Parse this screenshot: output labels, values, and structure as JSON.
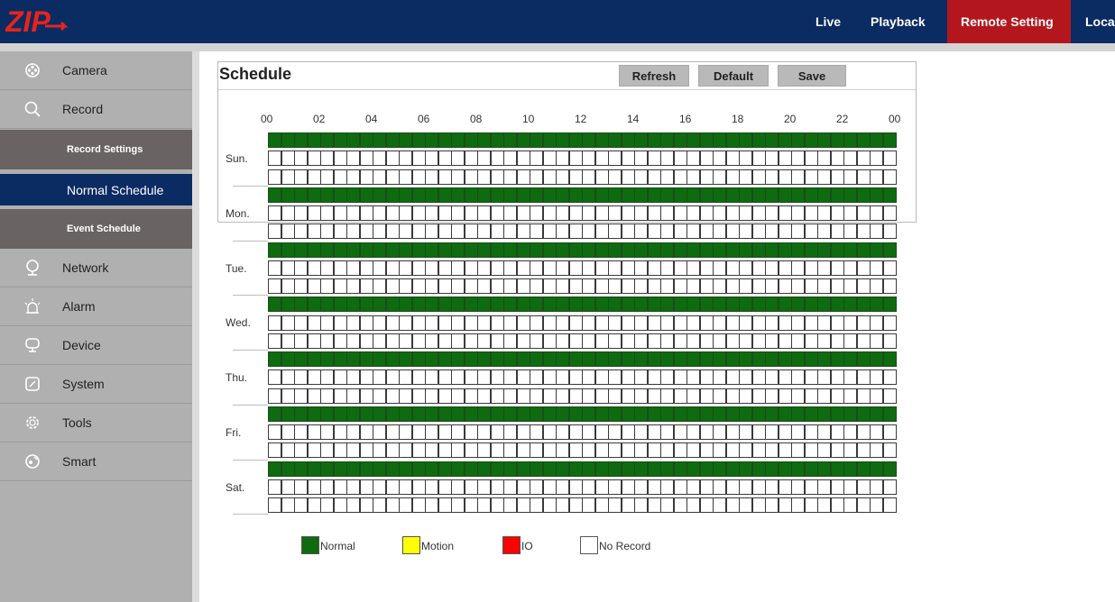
{
  "header": {
    "logo_text": "ZIP",
    "nav": [
      {
        "label": "Live",
        "active": false
      },
      {
        "label": "Playback",
        "active": false
      },
      {
        "label": "Remote Setting",
        "active": true
      },
      {
        "label": "Loca",
        "active": false
      }
    ]
  },
  "sidebar": {
    "items": [
      {
        "label": "Camera",
        "icon": "camera-icon"
      },
      {
        "label": "Record",
        "icon": "search-icon"
      },
      {
        "label": "Network",
        "icon": "network-icon"
      },
      {
        "label": "Alarm",
        "icon": "alarm-icon"
      },
      {
        "label": "Device",
        "icon": "device-icon"
      },
      {
        "label": "System",
        "icon": "system-icon"
      },
      {
        "label": "Tools",
        "icon": "tools-icon"
      },
      {
        "label": "Smart",
        "icon": "smart-icon"
      }
    ],
    "record_submenu": [
      {
        "label": "Record Settings",
        "selected": false
      },
      {
        "label": "Normal Schedule",
        "selected": true
      },
      {
        "label": "Event Schedule",
        "selected": false
      }
    ]
  },
  "schedule": {
    "title": "Schedule",
    "buttons": {
      "refresh": "Refresh",
      "default": "Default",
      "save": "Save"
    },
    "hour_labels": [
      "00",
      "02",
      "04",
      "06",
      "08",
      "10",
      "12",
      "14",
      "16",
      "18",
      "20",
      "22",
      "00"
    ],
    "days": [
      "Sun.",
      "Mon.",
      "Tue.",
      "Wed.",
      "Thu.",
      "Fri.",
      "Sat."
    ],
    "rows_per_day": [
      {
        "mode": "Normal",
        "hours_filled": 24
      },
      {
        "mode": "Motion",
        "hours_filled": 0
      },
      {
        "mode": "IO",
        "hours_filled": 0
      }
    ],
    "colors": {
      "normal": "#0f6b0f",
      "motion": "#ffff00",
      "io": "#ff0000",
      "no_record": "#ffffff"
    }
  },
  "legend": [
    {
      "label": "Normal",
      "color": "#0f6b0f"
    },
    {
      "label": "Motion",
      "color": "#ffff00"
    },
    {
      "label": "IO",
      "color": "#ff0000"
    },
    {
      "label": "No Record",
      "color": "#ffffff"
    }
  ]
}
